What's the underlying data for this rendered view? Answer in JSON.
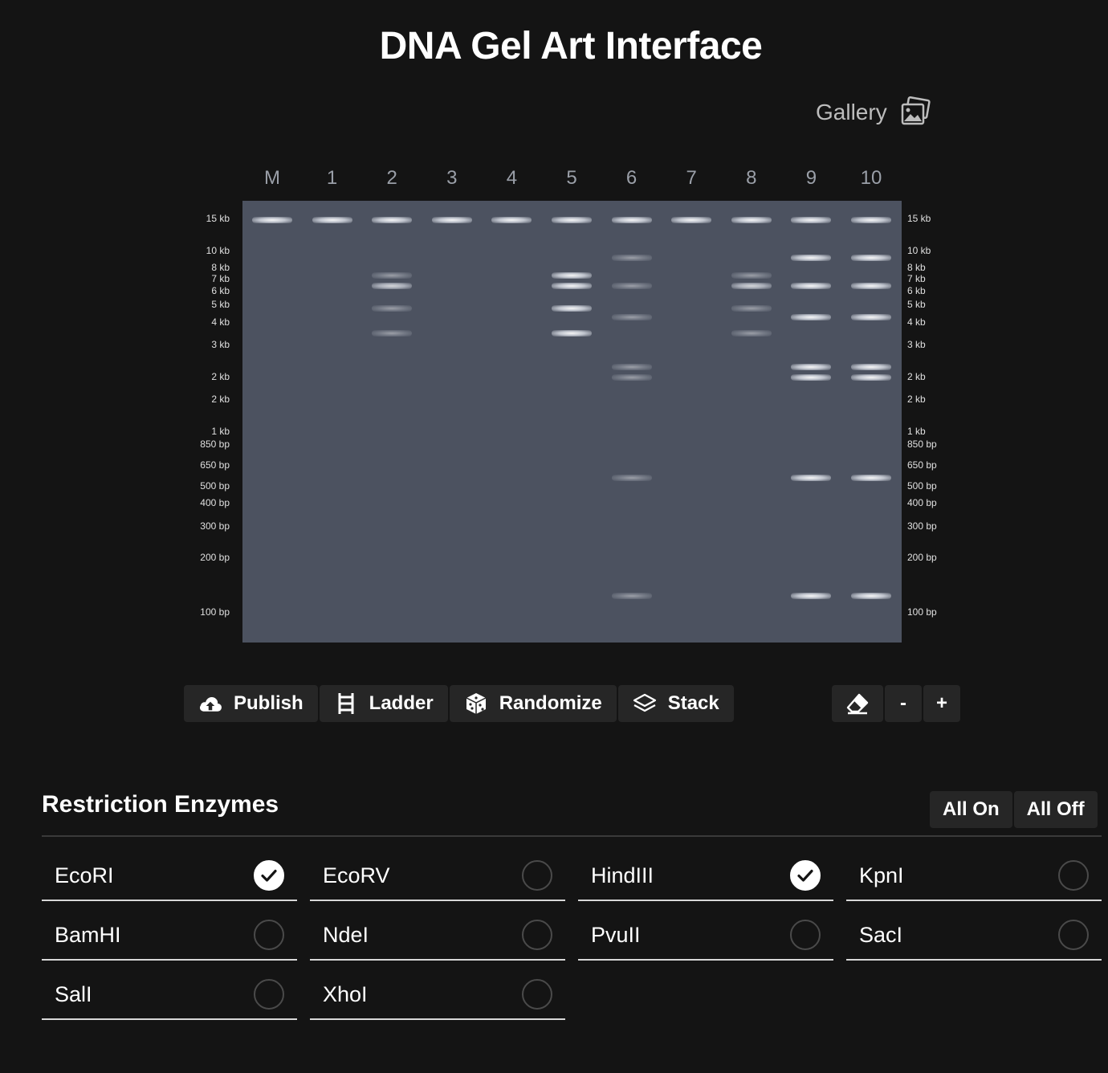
{
  "header": {
    "title": "DNA Gel Art Interface",
    "gallery_label": "Gallery"
  },
  "gel": {
    "lanes": [
      "M",
      "1",
      "2",
      "3",
      "4",
      "5",
      "6",
      "7",
      "8",
      "9",
      "10"
    ],
    "size_labels": [
      "15 kb",
      "10 kb",
      "8 kb",
      "7 kb",
      "6 kb",
      "5 kb",
      "4 kb",
      "3 kb",
      "2 kb",
      "2 kb",
      "1 kb",
      "850 bp",
      "650 bp",
      "500 bp",
      "400 bp",
      "300 bp",
      "200 bp",
      "100 bp"
    ],
    "bands": [
      {
        "lane": 0,
        "size": "15 kb",
        "intensity": "bright"
      },
      {
        "lane": 1,
        "size": "15 kb",
        "intensity": "bright"
      },
      {
        "lane": 2,
        "size": "15 kb",
        "intensity": "bright"
      },
      {
        "lane": 2,
        "size": "7 kb",
        "intensity": "dim"
      },
      {
        "lane": 2,
        "size": "6 kb",
        "intensity": "medium"
      },
      {
        "lane": 2,
        "size": "5 kb",
        "intensity": "dim"
      },
      {
        "lane": 2,
        "size": "3 kb",
        "intensity": "dim"
      },
      {
        "lane": 3,
        "size": "15 kb",
        "intensity": "bright"
      },
      {
        "lane": 4,
        "size": "15 kb",
        "intensity": "bright"
      },
      {
        "lane": 5,
        "size": "15 kb",
        "intensity": "bright"
      },
      {
        "lane": 5,
        "size": "7 kb",
        "intensity": "bright"
      },
      {
        "lane": 5,
        "size": "6 kb",
        "intensity": "bright"
      },
      {
        "lane": 5,
        "size": "5 kb",
        "intensity": "bright"
      },
      {
        "lane": 5,
        "size": "3 kb",
        "intensity": "bright"
      },
      {
        "lane": 6,
        "size": "15 kb",
        "intensity": "bright"
      },
      {
        "lane": 6,
        "size": "8 kb",
        "intensity": "dim"
      },
      {
        "lane": 6,
        "size": "6 kb",
        "intensity": "dim"
      },
      {
        "lane": 6,
        "size": "4 kb",
        "intensity": "dim"
      },
      {
        "lane": 6,
        "size": "2 kb",
        "intensity": "dim"
      },
      {
        "lane": 6,
        "size": "2 kb",
        "intensity": "dim"
      },
      {
        "lane": 6,
        "size": "500 bp",
        "intensity": "dim"
      },
      {
        "lane": 6,
        "size": "100 bp",
        "intensity": "dim"
      },
      {
        "lane": 7,
        "size": "15 kb",
        "intensity": "bright"
      },
      {
        "lane": 8,
        "size": "15 kb",
        "intensity": "bright"
      },
      {
        "lane": 8,
        "size": "7 kb",
        "intensity": "dim"
      },
      {
        "lane": 8,
        "size": "6 kb",
        "intensity": "medium"
      },
      {
        "lane": 8,
        "size": "5 kb",
        "intensity": "dim"
      },
      {
        "lane": 8,
        "size": "3 kb",
        "intensity": "dim"
      },
      {
        "lane": 9,
        "size": "15 kb",
        "intensity": "bright"
      },
      {
        "lane": 9,
        "size": "8 kb",
        "intensity": "bright"
      },
      {
        "lane": 9,
        "size": "6 kb",
        "intensity": "bright"
      },
      {
        "lane": 9,
        "size": "4 kb",
        "intensity": "bright"
      },
      {
        "lane": 9,
        "size": "2 kb",
        "intensity": "bright"
      },
      {
        "lane": 9,
        "size": "2 kb",
        "intensity": "bright"
      },
      {
        "lane": 9,
        "size": "500 bp",
        "intensity": "bright"
      },
      {
        "lane": 9,
        "size": "100 bp",
        "intensity": "bright"
      },
      {
        "lane": 10,
        "size": "15 kb",
        "intensity": "bright"
      },
      {
        "lane": 10,
        "size": "8 kb",
        "intensity": "bright"
      },
      {
        "lane": 10,
        "size": "6 kb",
        "intensity": "bright"
      },
      {
        "lane": 10,
        "size": "4 kb",
        "intensity": "bright"
      },
      {
        "lane": 10,
        "size": "2 kb",
        "intensity": "bright"
      },
      {
        "lane": 10,
        "size": "2 kb",
        "intensity": "bright"
      },
      {
        "lane": 10,
        "size": "500 bp",
        "intensity": "bright"
      },
      {
        "lane": 10,
        "size": "100 bp",
        "intensity": "bright"
      }
    ]
  },
  "toolbar": {
    "publish_label": "Publish",
    "ladder_label": "Ladder",
    "randomize_label": "Randomize",
    "stack_label": "Stack",
    "zoom_out_label": "-",
    "zoom_in_label": "+"
  },
  "enzymes": {
    "title": "Restriction Enzymes",
    "all_on_label": "All On",
    "all_off_label": "All Off",
    "items": [
      {
        "name": "EcoRI",
        "checked": true
      },
      {
        "name": "EcoRV",
        "checked": false
      },
      {
        "name": "HindIII",
        "checked": true
      },
      {
        "name": "KpnI",
        "checked": false
      },
      {
        "name": "BamHI",
        "checked": false
      },
      {
        "name": "NdeI",
        "checked": false
      },
      {
        "name": "PvuII",
        "checked": false
      },
      {
        "name": "SacI",
        "checked": false
      },
      {
        "name": "SalI",
        "checked": false
      },
      {
        "name": "XhoI",
        "checked": false
      }
    ]
  },
  "colors": {
    "background": "#141414",
    "gel": "#4c5260",
    "button": "#262626",
    "text": "#ffffff"
  }
}
